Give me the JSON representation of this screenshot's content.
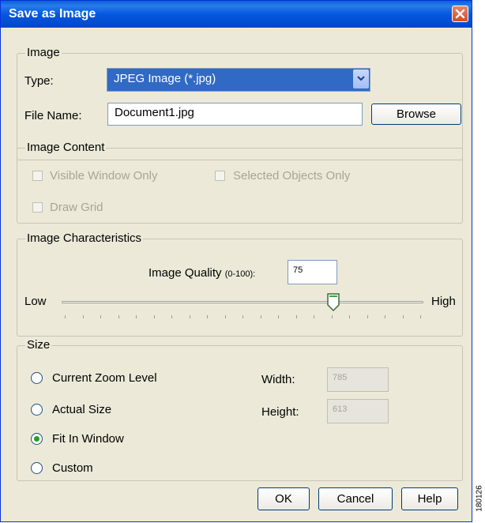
{
  "dialog": {
    "title": "Save as Image"
  },
  "image_group": {
    "legend": "Image",
    "type_label": "Type:",
    "type_value": "JPEG Image (*.jpg)",
    "file_name_label": "File Name:",
    "file_name_value": "Document1.jpg",
    "browse_label": "Browse"
  },
  "content_group": {
    "legend": "Image Content",
    "visible_window_only": "Visible Window Only",
    "selected_objects_only": "Selected Objects Only",
    "draw_grid": "Draw Grid"
  },
  "characteristics_group": {
    "legend": "Image Characteristics",
    "quality_label": "Image Quality",
    "quality_range": "(0-100):",
    "quality_value": "75",
    "low_label": "Low",
    "high_label": "High",
    "slider_value_percent": 75
  },
  "size_group": {
    "legend": "Size",
    "options": [
      "Current Zoom Level",
      "Actual Size",
      "Fit In Window",
      "Custom"
    ],
    "selected_option": "Fit In Window",
    "width_label": "Width:",
    "width_value": "785",
    "height_label": "Height:",
    "height_value": "613"
  },
  "buttons": {
    "ok": "OK",
    "cancel": "Cancel",
    "help": "Help"
  },
  "watermark": "180126",
  "colors": {
    "title_bar": "#0458e0",
    "selection": "#316ac5",
    "radio_selected": "#21a121",
    "close_button": "#d5492a"
  }
}
